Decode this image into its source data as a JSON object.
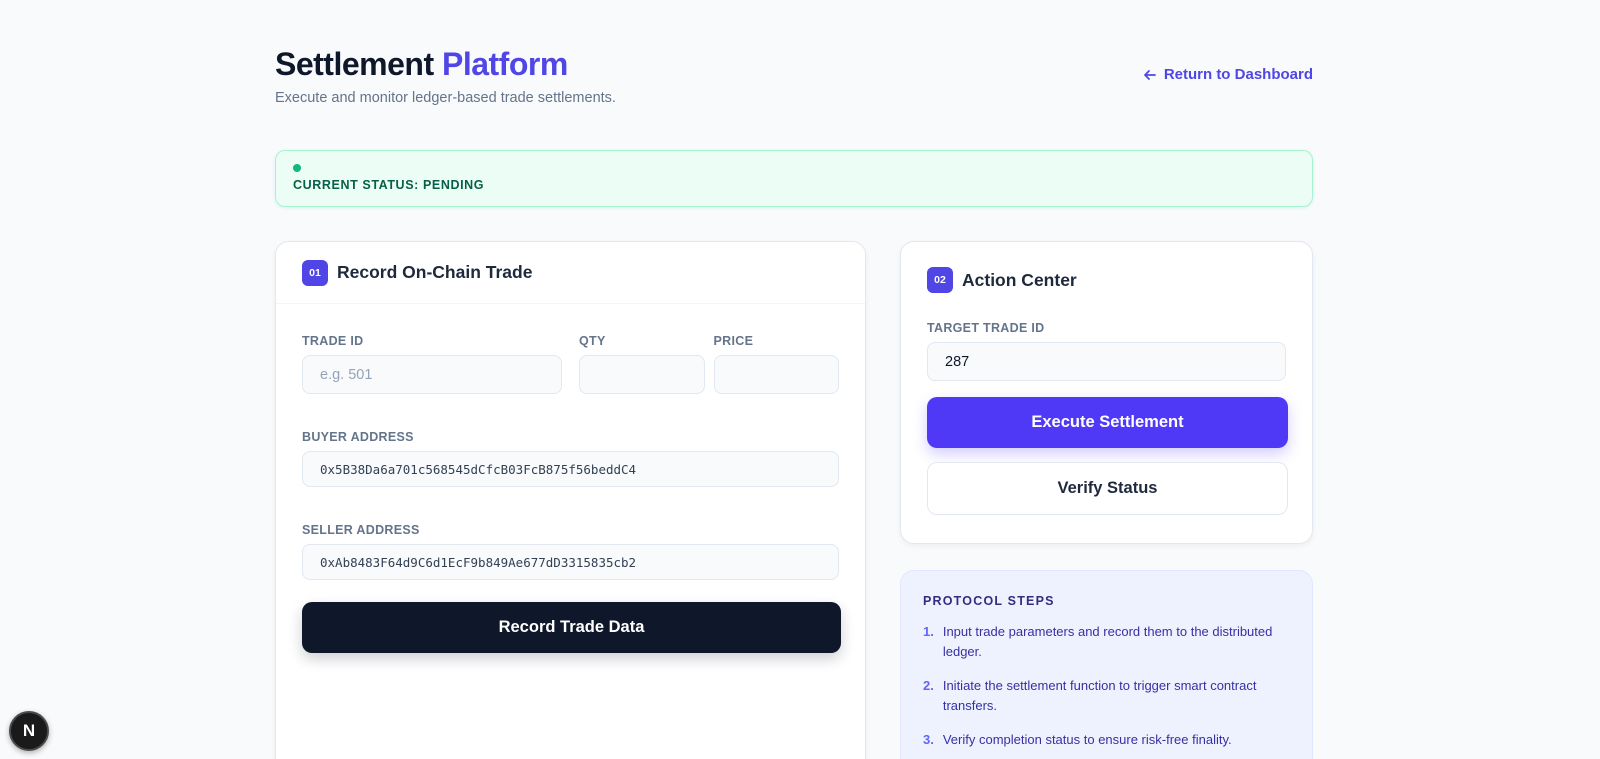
{
  "header": {
    "title_main": "Settlement",
    "title_accent": "Platform",
    "subtitle": "Execute and monitor ledger-based trade settlements.",
    "back_link": "Return to Dashboard"
  },
  "status": {
    "text": "CURRENT STATUS: PENDING",
    "color": "#10b981"
  },
  "record_card": {
    "badge": "01",
    "title": "Record On-Chain Trade",
    "trade_id_label": "TRADE ID",
    "trade_id_placeholder": "e.g. 501",
    "qty_label": "QTY",
    "price_label": "PRICE",
    "buyer_label": "BUYER ADDRESS",
    "buyer_value": "0x5B38Da6a701c568545dCfcB03FcB875f56beddC4",
    "seller_label": "SELLER ADDRESS",
    "seller_value": "0xAb8483F64d9C6d1EcF9b849Ae677dD3315835cb2",
    "submit_label": "Record Trade Data"
  },
  "action_card": {
    "badge": "02",
    "title": "Action Center",
    "target_label": "TARGET TRADE ID",
    "target_value": "287",
    "execute_label": "Execute Settlement",
    "verify_label": "Verify Status"
  },
  "protocol": {
    "title": "PROTOCOL STEPS",
    "steps": [
      {
        "num": "1.",
        "text": "Input trade parameters and record them to the distributed ledger."
      },
      {
        "num": "2.",
        "text": "Initiate the settlement function to trigger smart contract transfers."
      },
      {
        "num": "3.",
        "text": "Verify completion status to ensure risk-free finality."
      }
    ]
  },
  "floating": {
    "label": "N"
  },
  "colors": {
    "accent": "#4f46e5",
    "dark": "#0f172a"
  }
}
